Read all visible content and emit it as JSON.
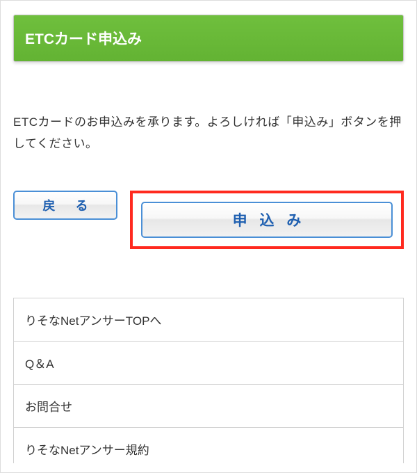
{
  "header": {
    "title": "ETCカード申込み"
  },
  "main": {
    "instructions": "ETCカードのお申込みを承ります。よろしければ「申込み」ボタンを押してください。"
  },
  "buttons": {
    "back_label": "戻 る",
    "apply_label": "申 込 み"
  },
  "menu": {
    "items": [
      {
        "label": "りそなNetアンサーTOPへ"
      },
      {
        "label": "Q＆A"
      },
      {
        "label": "お問合せ"
      },
      {
        "label": "りそなNetアンサー規約"
      }
    ]
  }
}
